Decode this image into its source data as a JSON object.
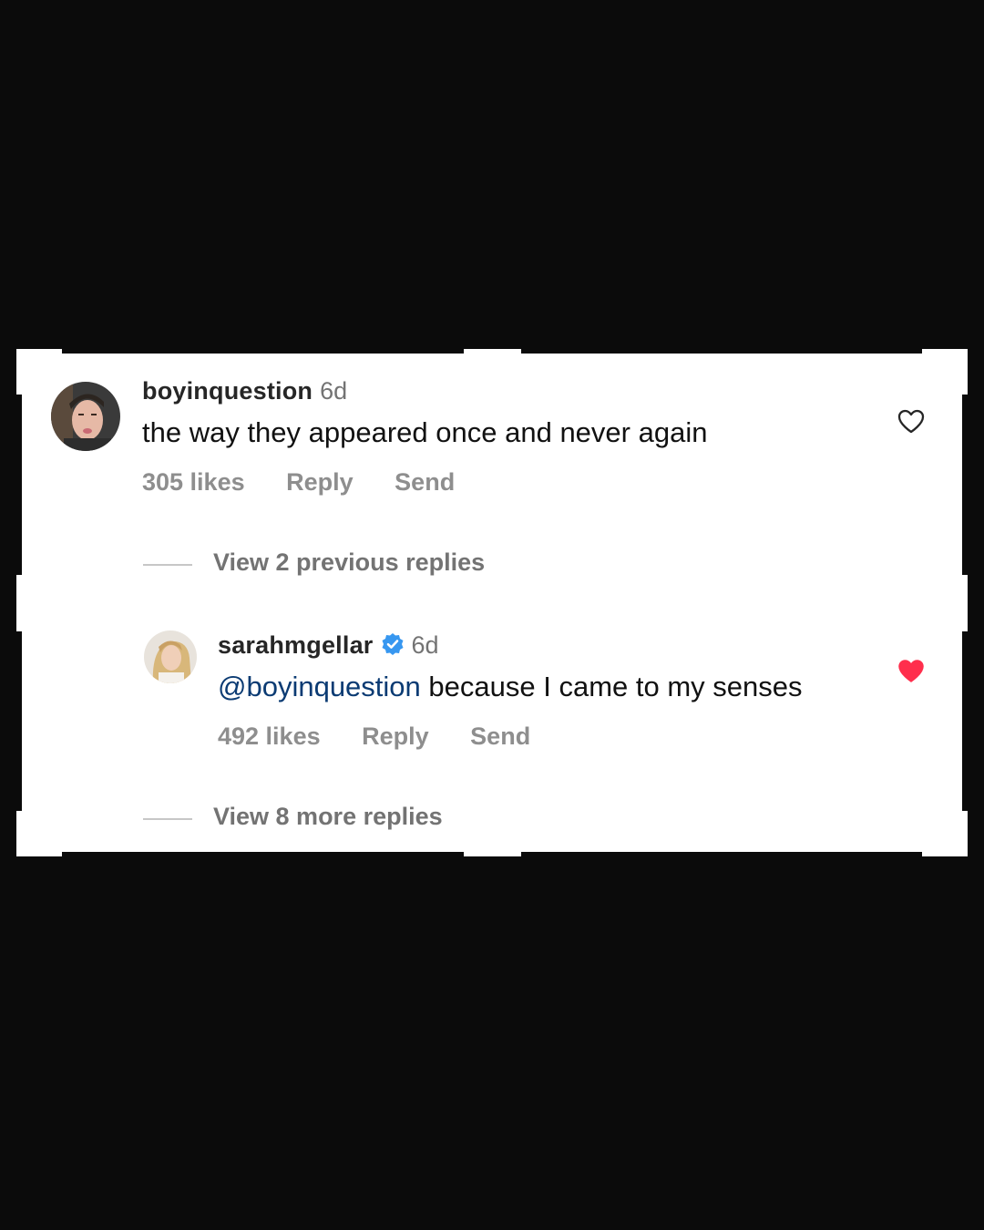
{
  "comment1": {
    "username": "boyinquestion",
    "time": "6d",
    "text": "the way they appeared once and never again",
    "likes": "305 likes",
    "reply": "Reply",
    "send": "Send",
    "liked": false
  },
  "view_previous": "View 2 previous replies",
  "comment2": {
    "username": "sarahmgellar",
    "verified": true,
    "time": "6d",
    "mention": "@boyinquestion",
    "text": " because I came to my senses",
    "likes": "492 likes",
    "reply": "Reply",
    "send": "Send",
    "liked": true
  },
  "view_more": "View 8 more replies",
  "colors": {
    "background": "#0b0b0b",
    "card": "#ffffff",
    "heart_liked": "#ff2e4c",
    "verified_badge": "#3797f0",
    "mention": "#0b3b73"
  }
}
